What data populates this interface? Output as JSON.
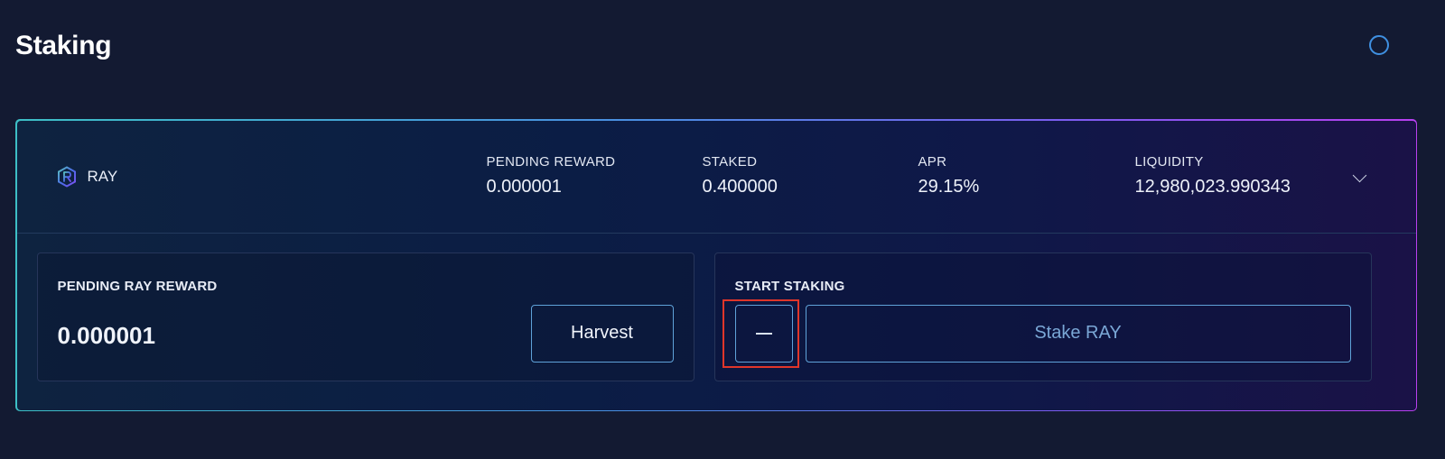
{
  "page": {
    "title": "Staking",
    "refresh_icon": "refresh-icon"
  },
  "pool": {
    "token": {
      "name": "RAY",
      "icon": "raydium-logo-icon"
    },
    "stats": {
      "pending_reward": {
        "label": "PENDING REWARD",
        "value": "0.000001"
      },
      "staked": {
        "label": "STAKED",
        "value": "0.400000"
      },
      "apr": {
        "label": "APR",
        "value": "29.15%"
      },
      "liquidity": {
        "label": "LIQUIDITY",
        "value": "12,980,023.990343"
      }
    },
    "expand_icon": "chevron-down-icon"
  },
  "harvest_panel": {
    "label": "PENDING RAY REWARD",
    "value": "0.000001",
    "button_label": "Harvest"
  },
  "stake_panel": {
    "label": "START STAKING",
    "minus_icon": "minus-icon",
    "button_label": "Stake RAY"
  },
  "colors": {
    "background": "#131a32",
    "card_border_gradient": [
      "#3dbfc6",
      "#4a8de2",
      "#7c5cf0",
      "#b83ff0"
    ],
    "button_border": "#5fa2d9",
    "refresh_icon": "#3f8fe0",
    "highlight": "#e0362a"
  }
}
